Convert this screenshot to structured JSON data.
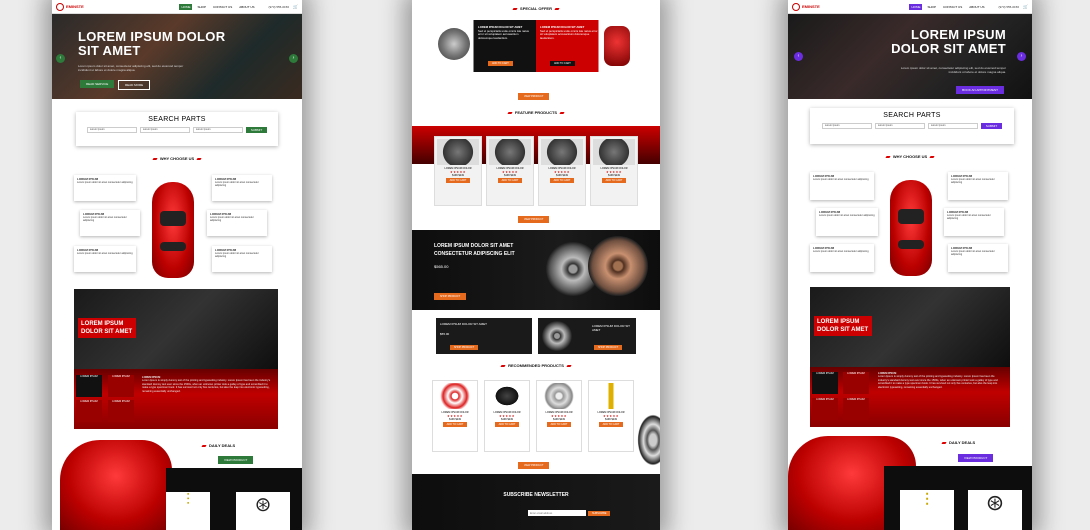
{
  "colors": {
    "brand_red": "#cc0000",
    "green": "#2d7a3a",
    "purple": "#6a2de0",
    "orange": "#e66a1e"
  },
  "header": {
    "logo": "EMINSTE",
    "nav": [
      "HOME",
      "SHOP",
      "CONTACT US",
      "ABOUT US"
    ],
    "phone": "(973) 555-0156",
    "cart_icon": "cart-icon"
  },
  "hero": {
    "title": "LOREM IPSUM DOLOR SIT AMET",
    "subtitle": "Lorem ipsum dolor sit amet, consectetur adipiscing elit, sed do eiusmod tempor incididunt ut labore et dolore magna aliqua.",
    "btn_primary": "READ SERVICE",
    "btn_secondary": "READ MORE",
    "btn_appointment": "BOOK AN APPOINTMENT"
  },
  "search": {
    "title": "SEARCH PARTS",
    "selects": [
      "Lorem Ipsum",
      "Lorem Ipsum",
      "Lorem Ipsum"
    ],
    "button": "SUBMIT"
  },
  "why": {
    "title": "WHY CHOOSE US",
    "cards": [
      {
        "title": "LOREM IPSUM",
        "text": "Lorem ipsum dolor sit amet consectetur adipiscing"
      },
      {
        "title": "LOREM IPSUM",
        "text": "Lorem ipsum dolor sit amet consectetur adipiscing"
      },
      {
        "title": "LOREM IPSUM",
        "text": "Lorem ipsum dolor sit amet consectetur adipiscing"
      },
      {
        "title": "LOREM IPSUM",
        "text": "Lorem ipsum dolor sit amet consectetur adipiscing"
      },
      {
        "title": "LOREM IPSUM",
        "text": "Lorem ipsum dolor sit amet consectetur adipiscing"
      },
      {
        "title": "LOREM IPSUM",
        "text": "Lorem ipsum dolor sit amet consectetur adipiscing"
      }
    ]
  },
  "promo": {
    "tag": "LOREM IPSUM DOLOR SIT AMET",
    "heading": "LOREM IPSUM",
    "text": "Lorem Ipsum is simply dummy text of the printing and typesetting industry. Lorem Ipsum has been the industry's standard dummy text ever since the 1500s, when an unknown printer took a galley of type and scrambled it to make a type specimen book. It has survived not only five centuries, but also the leap into electronic typesetting, remaining essentially unchanged.",
    "tiles": [
      "LOREM IPSUM",
      "LOREM IPSUM",
      "LOREM IPSUM",
      "LOREM IPSUM"
    ]
  },
  "deals": {
    "title": "DAILY DEALS",
    "button": "VIEW PRODUCT"
  },
  "offer": {
    "title": "SPECIAL OFFER",
    "items": [
      {
        "title": "LOREM IPSUM DOLOR SIT AMET",
        "text": "Sed ut perspiciatis unde omnis iste natus error sit voluptatem accusantium doloremque laudantium.",
        "button": "ADD TO CART"
      },
      {
        "title": "LOREM IPSUM DOLOR SIT AMET",
        "text": "Sed ut perspiciatis unde omnis iste natus error sit voluptatem accusantium doloremque laudantium.",
        "button": "ADD TO CART"
      }
    ],
    "more": "VIEW PRODUCT"
  },
  "featured": {
    "title": "FEATURE PRODUCTS",
    "products": [
      {
        "name": "LOREM IPSUM DOLOR",
        "price": "$199  $249",
        "button": "ADD TO CART"
      },
      {
        "name": "LOREM IPSUM DOLOR",
        "price": "$199  $249",
        "button": "ADD TO CART"
      },
      {
        "name": "LOREM IPSUM DOLOR",
        "price": "$199  $249",
        "button": "ADD TO CART"
      },
      {
        "name": "LOREM IPSUM DOLOR",
        "price": "$199  $249",
        "button": "ADD TO CART"
      }
    ],
    "more": "VIEW PRODUCT"
  },
  "wheels": {
    "title": "LOREM IPSUM DOLOR SIT AMET CONSECTETUR ADIPISCING ELIT",
    "price": "$565.00",
    "button": "SHOP PRODUCT",
    "mini": [
      {
        "tag": "LOREM IPSUM DOLOR SIT AMET",
        "price": "$55.00",
        "button": "SHOP PRODUCT"
      },
      {
        "tag": "LOREM IPSUM DOLOR SIT AMET",
        "price": "",
        "button": "SHOP PRODUCT"
      }
    ]
  },
  "recommended": {
    "title": "RECOMMENDED PRODUCTS",
    "products": [
      {
        "name": "LOREM IPSUM DOLOR",
        "price": "$199  $249",
        "button": "ADD TO CART"
      },
      {
        "name": "LOREM IPSUM DOLOR",
        "price": "$199  $249",
        "button": "ADD TO CART"
      },
      {
        "name": "LOREM IPSUM DOLOR",
        "price": "$199  $249",
        "button": "ADD TO CART"
      },
      {
        "name": "LOREM IPSUM DOLOR",
        "price": "$199  $249",
        "button": "ADD TO CART"
      }
    ],
    "more": "VIEW PRODUCT"
  },
  "newsletter": {
    "title": "SUBSCRIBE NEWSLETTER",
    "placeholder": "Enter email address",
    "button": "SUBSCRIBE"
  }
}
